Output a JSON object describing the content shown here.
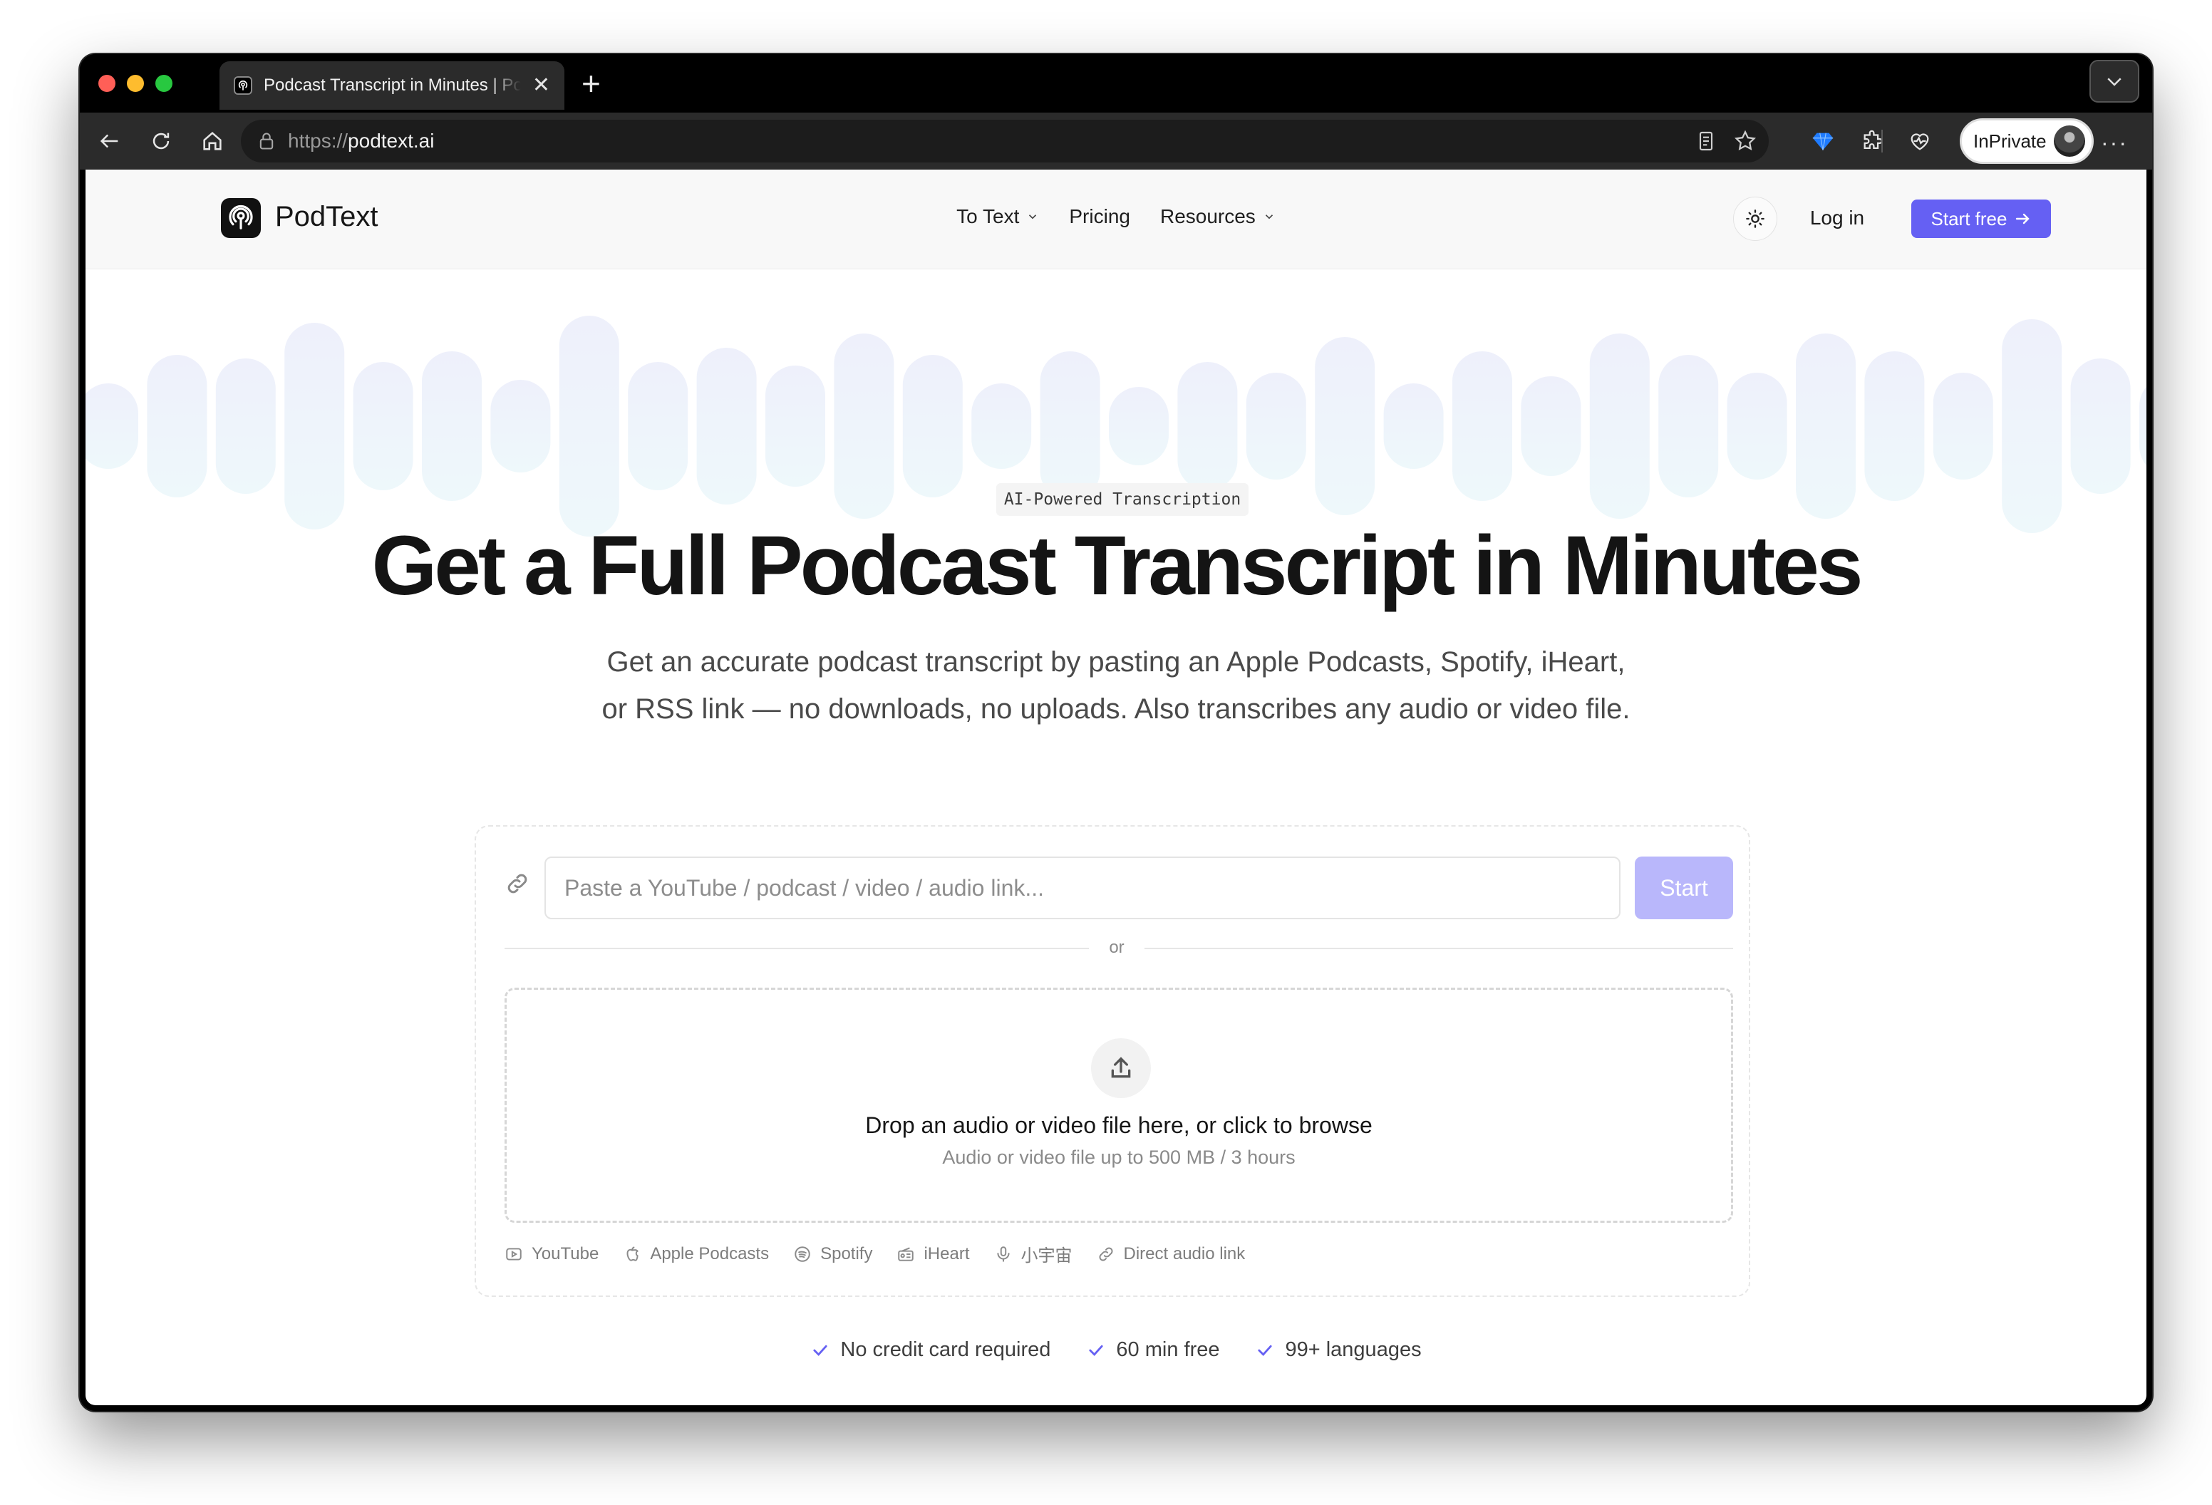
{
  "browser": {
    "tab_title": "Podcast Transcript in Minutes | PodText",
    "tab_close": "✕",
    "new_tab": "+",
    "url_protocol": "https://",
    "url_host": "podtext.ai",
    "inprivate_label": "InPrivate",
    "more": "···"
  },
  "site": {
    "logo_text": "PodText",
    "nav": [
      {
        "label": "To Text",
        "has_dropdown": true
      },
      {
        "label": "Pricing",
        "has_dropdown": false
      },
      {
        "label": "Resources",
        "has_dropdown": true
      }
    ],
    "login": "Log in",
    "cta": "Start free",
    "accent_color": "#6560f3"
  },
  "hero": {
    "badge": "AI-Powered Transcription",
    "headline": "Get a Full Podcast Transcript in Minutes",
    "subline_1": "Get an accurate podcast transcript by pasting an Apple Podcasts, Spotify, iHeart,",
    "subline_2": "or RSS link — no downloads, no uploads. Also transcribes any audio or video file."
  },
  "input": {
    "placeholder": "Paste a YouTube / podcast / video / audio link...",
    "value": "",
    "start": "Start",
    "or": "or"
  },
  "dropzone": {
    "title": "Drop an audio or video file here, or click to browse",
    "subtitle": "Audio or video file up to 500 MB / 3 hours"
  },
  "sources": [
    {
      "icon": "youtube-icon",
      "label": "YouTube"
    },
    {
      "icon": "apple-icon",
      "label": "Apple Podcasts"
    },
    {
      "icon": "spotify-icon",
      "label": "Spotify"
    },
    {
      "icon": "radio-icon",
      "label": "iHeart"
    },
    {
      "icon": "mic-icon",
      "label": "小宇宙"
    },
    {
      "icon": "link-icon",
      "label": "Direct audio link"
    }
  ],
  "perks": [
    "No credit card required",
    "60 min free",
    "99+ languages"
  ]
}
